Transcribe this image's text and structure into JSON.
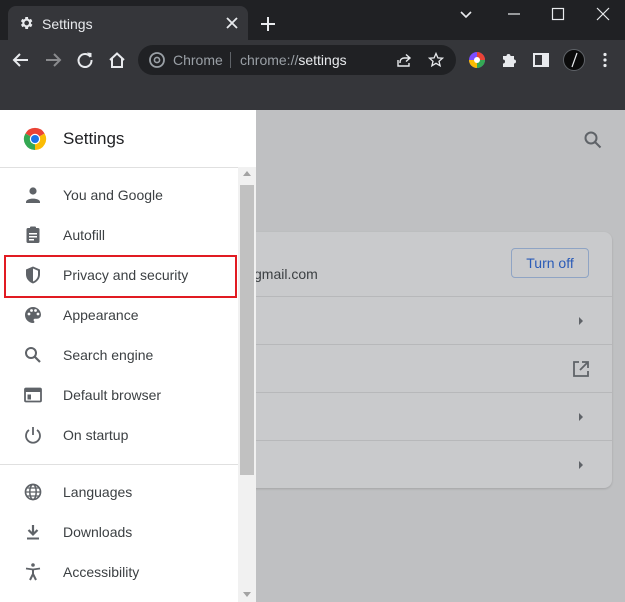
{
  "tab": {
    "title": "Settings"
  },
  "omnibox": {
    "site_label": "Chrome",
    "url_scheme": "chrome://",
    "url_host": "settings"
  },
  "drawer": {
    "title": "Settings",
    "items": [
      {
        "label": "You and Google",
        "icon": "person-icon"
      },
      {
        "label": "Autofill",
        "icon": "clipboard-icon"
      },
      {
        "label": "Privacy and security",
        "icon": "shield-icon",
        "highlighted": true
      },
      {
        "label": "Appearance",
        "icon": "palette-icon"
      },
      {
        "label": "Search engine",
        "icon": "search-icon"
      },
      {
        "label": "Default browser",
        "icon": "browser-window-icon"
      },
      {
        "label": "On startup",
        "icon": "power-icon"
      },
      {
        "label": "Languages",
        "icon": "globe-icon"
      },
      {
        "label": "Downloads",
        "icon": "download-icon"
      },
      {
        "label": "Accessibility",
        "icon": "accessibility-icon"
      }
    ]
  },
  "main": {
    "account_email_partial": "gmail.com",
    "turn_off_label": "Turn off"
  },
  "colors": {
    "highlight": "#e11b22",
    "accent": "#1a73e8",
    "chrome_dark": "#202124",
    "toolbar": "#35363a"
  }
}
